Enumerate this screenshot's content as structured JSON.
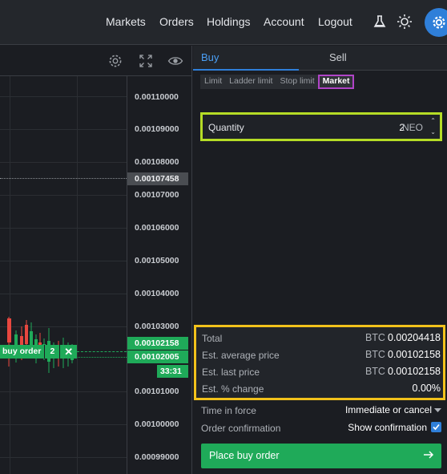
{
  "nav": {
    "links": [
      "Markets",
      "Orders",
      "Holdings",
      "Account",
      "Logout"
    ],
    "icons": [
      "flask-icon",
      "sun-icon",
      "gear-icon"
    ]
  },
  "chart": {
    "y_ticks": [
      "0.00110000",
      "0.00109000",
      "0.00108000",
      "0.00107000",
      "0.00106000",
      "0.00105000",
      "0.00104000",
      "0.00103000",
      "0.00101000",
      "0.00100000",
      "0.00099000"
    ],
    "last_price_tag": "0.00107458",
    "price_tag_1": "0.00102158",
    "price_tag_2": "0.00102005",
    "countdown": "33:31",
    "order_label": "buy order",
    "order_qty": "2",
    "order_close": "✕"
  },
  "order": {
    "tabs": {
      "buy": "Buy",
      "sell": "Sell"
    },
    "types": [
      "Limit",
      "Ladder limit",
      "Stop limit",
      "Market"
    ],
    "active_type": "Market",
    "quantity": {
      "label": "Quantity",
      "value": "2",
      "unit": "NEO"
    },
    "summary": [
      {
        "label": "Total",
        "currency": "BTC",
        "value": "0.00204418"
      },
      {
        "label": "Est. average price",
        "currency": "BTC",
        "value": "0.00102158"
      },
      {
        "label": "Est. last price",
        "currency": "BTC",
        "value": "0.00102158"
      },
      {
        "label": "Est. % change",
        "currency": "",
        "value": "0.00%"
      }
    ],
    "time_in_force": {
      "label": "Time in force",
      "value": "Immediate or cancel"
    },
    "confirmation": {
      "label": "Order confirmation",
      "value": "Show confirmation",
      "checked": true
    },
    "submit_label": "Place buy order"
  },
  "colors": {
    "accent": "#2f7fd9",
    "buy_green": "#1faa59",
    "sell_red": "#e8473f",
    "highlight_lime": "#b5dc26",
    "highlight_yellow": "#f2c21b",
    "highlight_purple": "#b044c7"
  }
}
